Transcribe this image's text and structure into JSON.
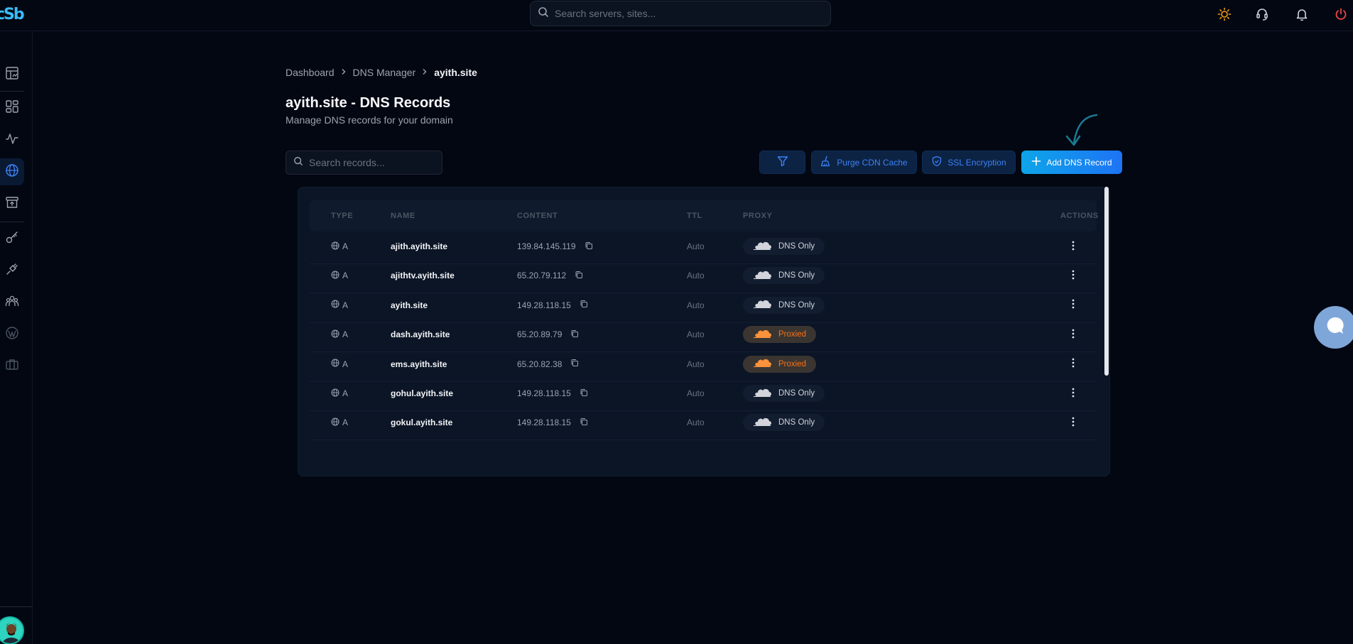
{
  "app": {
    "logo_text": "cSb",
    "search_placeholder": "Search servers, sites..."
  },
  "topbar_icons": [
    "sun-icon",
    "headset-icon",
    "bell-icon",
    "power-icon"
  ],
  "sidebar": {
    "items": [
      {
        "icon": "dashboard-icon"
      },
      {
        "icon": "apps-grid-icon"
      },
      {
        "icon": "activity-icon"
      },
      {
        "icon": "globe-icon",
        "active": true
      },
      {
        "icon": "storage-icon"
      },
      {
        "icon": "key-icon"
      },
      {
        "icon": "plug-icon"
      },
      {
        "icon": "team-icon"
      },
      {
        "icon": "wordpress-icon"
      },
      {
        "icon": "briefcase-icon"
      }
    ]
  },
  "breadcrumb": {
    "items": [
      "Dashboard",
      "DNS Manager"
    ],
    "current": "ayith.site"
  },
  "page": {
    "title": "ayith.site - DNS Records",
    "subtitle": "Manage DNS records for your domain"
  },
  "toolbar": {
    "search_placeholder": "Search records...",
    "purge_label": "Purge CDN Cache",
    "ssl_label": "SSL Encryption",
    "add_label": "Add DNS Record"
  },
  "table": {
    "headers": {
      "type": "TYPE",
      "name": "NAME",
      "content": "CONTENT",
      "ttl": "TTL",
      "proxy": "PROXY",
      "actions": "ACTIONS"
    },
    "rows": [
      {
        "type": "A",
        "name": "ajith.ayith.site",
        "content": "139.84.145.119",
        "ttl": "Auto",
        "proxy": "DNS Only"
      },
      {
        "type": "A",
        "name": "ajithtv.ayith.site",
        "content": "65.20.79.112",
        "ttl": "Auto",
        "proxy": "DNS Only"
      },
      {
        "type": "A",
        "name": "ayith.site",
        "content": "149.28.118.15",
        "ttl": "Auto",
        "proxy": "DNS Only"
      },
      {
        "type": "A",
        "name": "dash.ayith.site",
        "content": "65.20.89.79",
        "ttl": "Auto",
        "proxy": "Proxied"
      },
      {
        "type": "A",
        "name": "ems.ayith.site",
        "content": "65.20.82.38",
        "ttl": "Auto",
        "proxy": "Proxied"
      },
      {
        "type": "A",
        "name": "gohul.ayith.site",
        "content": "149.28.118.15",
        "ttl": "Auto",
        "proxy": "DNS Only"
      },
      {
        "type": "A",
        "name": "gokul.ayith.site",
        "content": "149.28.118.15",
        "ttl": "Auto",
        "proxy": "DNS Only"
      }
    ]
  },
  "colors": {
    "background": "#030712",
    "accent": "#1d74f5",
    "proxied": "#f97316"
  }
}
